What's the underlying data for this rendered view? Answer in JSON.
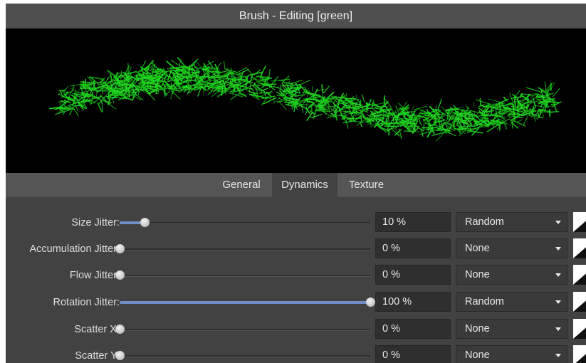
{
  "window": {
    "title": "Brush - Editing [green]"
  },
  "tabs": [
    {
      "label": "General",
      "active": false
    },
    {
      "label": "Dynamics",
      "active": true
    },
    {
      "label": "Texture",
      "active": false
    }
  ],
  "stroke_color": "#1fd61f",
  "controls": [
    {
      "label": "Size Jitter:",
      "fraction": 0.1,
      "value": "10 %",
      "mode": "Random"
    },
    {
      "label": "Accumulation Jitter:",
      "fraction": 0.0,
      "value": "0 %",
      "mode": "None"
    },
    {
      "label": "Flow Jitter:",
      "fraction": 0.0,
      "value": "0 %",
      "mode": "None"
    },
    {
      "label": "Rotation Jitter:",
      "fraction": 1.0,
      "value": "100 %",
      "mode": "Random"
    },
    {
      "label": "Scatter X:",
      "fraction": 0.0,
      "value": "0 %",
      "mode": "None"
    },
    {
      "label": "Scatter Y:",
      "fraction": 0.0,
      "value": "0 %",
      "mode": "None"
    }
  ]
}
